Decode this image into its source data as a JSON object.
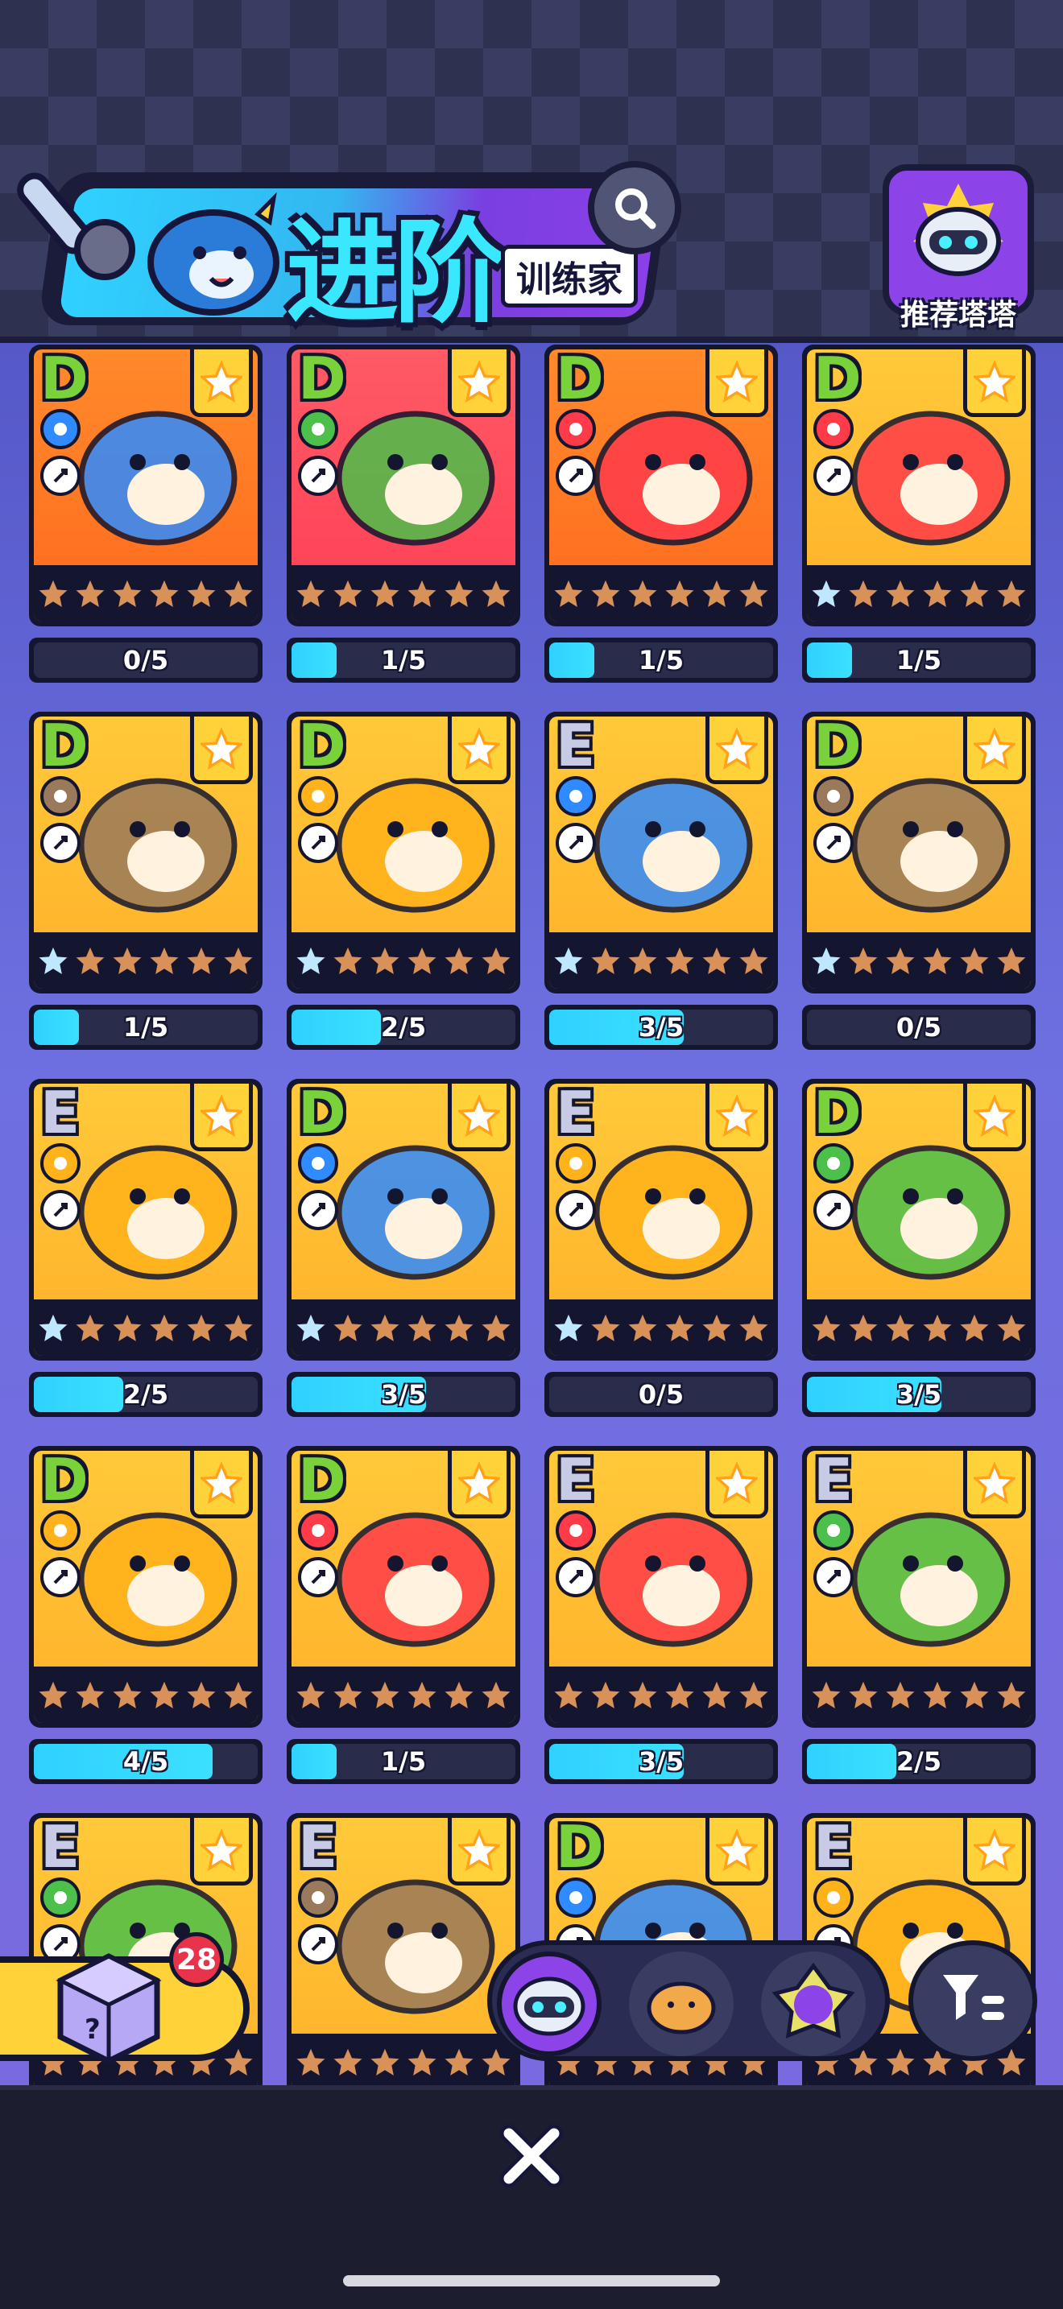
{
  "header": {
    "title": "进阶",
    "subtitle": "训练家",
    "recommend_label": "推荐塔塔"
  },
  "colors": {
    "grade_D": "#7ad23b",
    "grade_E": "#c8cbe6",
    "progress_fill": "#2fd1ff",
    "card_frame": "#14152e"
  },
  "cards": [
    {
      "grade": "D",
      "element": "water",
      "role": "attack",
      "bg": "orange",
      "progress_text": "0/5",
      "progress": 0,
      "blue_star": false
    },
    {
      "grade": "D",
      "element": "grass",
      "role": "attack",
      "bg": "red",
      "progress_text": "1/5",
      "progress": 0.2,
      "blue_star": false
    },
    {
      "grade": "D",
      "element": "fire",
      "role": "attack",
      "bg": "orange",
      "progress_text": "1/5",
      "progress": 0.2,
      "blue_star": false
    },
    {
      "grade": "D",
      "element": "fire",
      "role": "support",
      "bg": "yellow",
      "progress_text": "1/5",
      "progress": 0.2,
      "blue_star": true
    },
    {
      "grade": "D",
      "element": "earth",
      "role": "support",
      "bg": "yellow",
      "progress_text": "1/5",
      "progress": 0.2,
      "blue_star": true
    },
    {
      "grade": "D",
      "element": "electric",
      "role": "magic",
      "bg": "yellow",
      "progress_text": "2/5",
      "progress": 0.4,
      "blue_star": true
    },
    {
      "grade": "E",
      "element": "water",
      "role": "magic",
      "bg": "yellow",
      "progress_text": "3/5",
      "progress": 0.6,
      "blue_star": true
    },
    {
      "grade": "D",
      "element": "earth",
      "role": "support",
      "bg": "yellow",
      "progress_text": "0/5",
      "progress": 0,
      "blue_star": true
    },
    {
      "grade": "E",
      "element": "electric",
      "role": "attack",
      "bg": "yellow",
      "progress_text": "2/5",
      "progress": 0.4,
      "blue_star": true
    },
    {
      "grade": "D",
      "element": "water",
      "role": "support",
      "bg": "yellow",
      "progress_text": "3/5",
      "progress": 0.6,
      "blue_star": true
    },
    {
      "grade": "E",
      "element": "electric",
      "role": "magic",
      "bg": "yellow",
      "progress_text": "0/5",
      "progress": 0,
      "blue_star": true
    },
    {
      "grade": "D",
      "element": "grass",
      "role": "support",
      "bg": "yellow",
      "progress_text": "3/5",
      "progress": 0.6,
      "blue_star": false
    },
    {
      "grade": "D",
      "element": "electric",
      "role": "attack",
      "bg": "yellow",
      "progress_text": "4/5",
      "progress": 0.8,
      "blue_star": false
    },
    {
      "grade": "D",
      "element": "fire",
      "role": "attack",
      "bg": "yellow",
      "progress_text": "1/5",
      "progress": 0.2,
      "blue_star": false
    },
    {
      "grade": "E",
      "element": "fire",
      "role": "heal",
      "bg": "yellow",
      "progress_text": "3/5",
      "progress": 0.6,
      "blue_star": false
    },
    {
      "grade": "E",
      "element": "grass",
      "role": "attack",
      "bg": "yellow",
      "progress_text": "2/5",
      "progress": 0.4,
      "blue_star": false
    },
    {
      "grade": "E",
      "element": "grass",
      "role": "attack",
      "bg": "yellow",
      "progress_text": "",
      "progress": null,
      "blue_star": false
    },
    {
      "grade": "E",
      "element": "earth",
      "role": "attack",
      "bg": "yellow",
      "progress_text": "",
      "progress": null,
      "blue_star": false
    },
    {
      "grade": "D",
      "element": "water",
      "role": "attack",
      "bg": "yellow",
      "progress_text": "",
      "progress": null,
      "blue_star": false
    },
    {
      "grade": "E",
      "element": "electric",
      "role": "attack",
      "bg": "yellow",
      "progress_text": "",
      "progress": null,
      "blue_star": false
    }
  ],
  "mystery_box": {
    "count": "28",
    "icon": "mystery-cube-icon"
  },
  "tabs": [
    {
      "icon": "cat-robot-icon",
      "active": true
    },
    {
      "icon": "bread-icon",
      "active": false
    },
    {
      "icon": "crystal-cat-icon",
      "active": false
    }
  ],
  "filter_icon": "filter-icon",
  "close_icon": "close-icon"
}
